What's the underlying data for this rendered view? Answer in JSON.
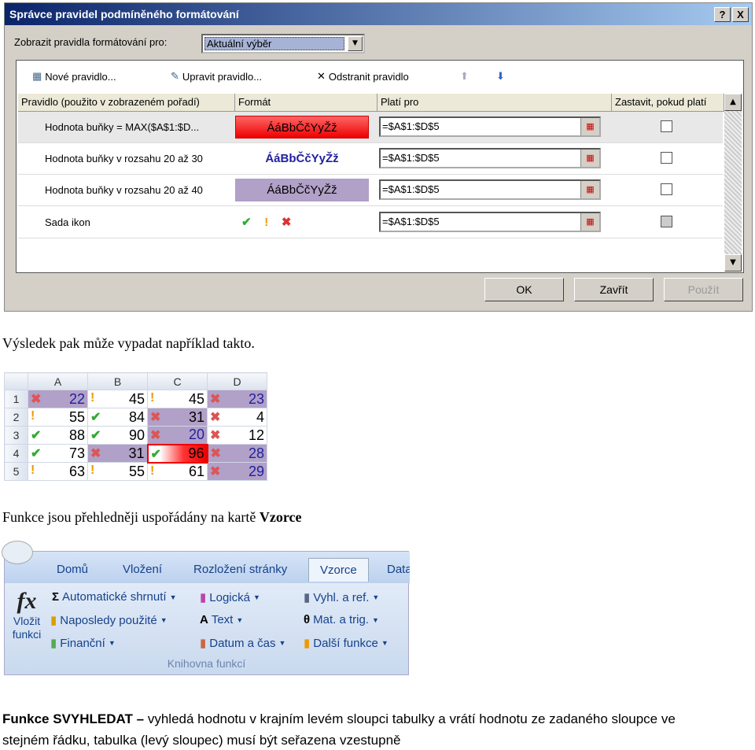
{
  "dialog": {
    "title": "Správce pravidel podmíněného formátování",
    "help": "?",
    "close": "X",
    "show_label": "Zobrazit pravidla formátování pro:",
    "show_value": "Aktuální výběr",
    "toolbar": {
      "new": "Nové pravidlo...",
      "edit": "Upravit pravidlo...",
      "delete": "Odstranit pravidlo"
    },
    "columns": [
      "Pravidlo (použito v zobrazeném pořadí)",
      "Formát",
      "Platí pro",
      "Zastavit, pokud platí"
    ],
    "rules": [
      {
        "rule": "Hodnota buňky = MAX($A$1:$D...",
        "format": "ÁáBbČčYyŽž",
        "applies": "=$A$1:$D$5"
      },
      {
        "rule": "Hodnota buňky v rozsahu 20 až 30",
        "format": "ÁáBbČčYyŽž",
        "applies": "=$A$1:$D$5"
      },
      {
        "rule": "Hodnota buňky v rozsahu 20 až 40",
        "format": "ÁáBbČčYyŽž",
        "applies": "=$A$1:$D$5"
      },
      {
        "rule": "Sada ikon",
        "format": "",
        "applies": "=$A$1:$D$5"
      }
    ],
    "buttons": {
      "ok": "OK",
      "close": "Zavřít",
      "apply": "Použít"
    }
  },
  "text1": "Výsledek pak může vypadat například takto.",
  "sheet": {
    "cols": [
      "A",
      "B",
      "C",
      "D"
    ],
    "rows": [
      [
        {
          "v": "22",
          "i": "x",
          "f": "purple",
          "b": true
        },
        {
          "v": "45",
          "i": "!"
        },
        {
          "v": "45",
          "i": "!"
        },
        {
          "v": "23",
          "i": "x",
          "f": "purple",
          "b": true
        }
      ],
      [
        {
          "v": "55",
          "i": "!"
        },
        {
          "v": "84",
          "i": "v"
        },
        {
          "v": "31",
          "i": "x",
          "f": "purple"
        },
        {
          "v": "4",
          "i": "x"
        }
      ],
      [
        {
          "v": "88",
          "i": "v"
        },
        {
          "v": "90",
          "i": "v"
        },
        {
          "v": "20",
          "i": "x",
          "f": "purple",
          "b": true
        },
        {
          "v": "12",
          "i": "x"
        }
      ],
      [
        {
          "v": "73",
          "i": "v"
        },
        {
          "v": "31",
          "i": "x",
          "f": "purple"
        },
        {
          "v": "96",
          "i": "v",
          "f": "red"
        },
        {
          "v": "28",
          "i": "x",
          "f": "purple",
          "b": true
        }
      ],
      [
        {
          "v": "63",
          "i": "!"
        },
        {
          "v": "55",
          "i": "!"
        },
        {
          "v": "61",
          "i": "!"
        },
        {
          "v": "29",
          "i": "x",
          "f": "purple",
          "b": true
        }
      ]
    ]
  },
  "text2": {
    "pre": "Funkce jsou přehledněji uspořádány na kartě ",
    "bold": "Vzorce"
  },
  "ribbon": {
    "tabs": [
      "Domů",
      "Vložení",
      "Rozložení stránky",
      "Vzorce",
      "Data"
    ],
    "insert1": "Vložit",
    "insert2": "funkci",
    "items": [
      "Automatické shrnutí",
      "Naposledy použité",
      "Finanční",
      "Logická",
      "Text",
      "Datum a čas",
      "Vyhl. a ref.",
      "Mat. a trig.",
      "Další funkce"
    ],
    "group": "Knihovna funkcí"
  },
  "text3": {
    "bold": "Funkce SVYHLEDAT – ",
    "rest": "vyhledá hodnotu v krajním levém sloupci tabulky a vrátí hodnotu ze zadaného sloupce ve",
    "line2": "stejném řádku, tabulka (levý sloupec) musí být seřazena vzestupně"
  }
}
